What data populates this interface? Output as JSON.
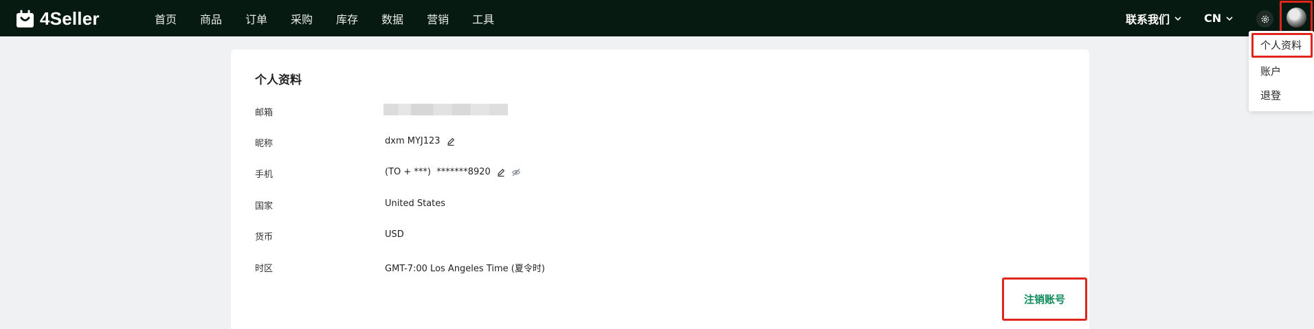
{
  "brand": {
    "name": "4Seller"
  },
  "nav": {
    "items": [
      {
        "label": "首页"
      },
      {
        "label": "商品"
      },
      {
        "label": "订单"
      },
      {
        "label": "采购"
      },
      {
        "label": "库存"
      },
      {
        "label": "数据"
      },
      {
        "label": "营销"
      },
      {
        "label": "工具"
      }
    ],
    "contact_label": "联系我们",
    "lang_label": "CN"
  },
  "user_menu": {
    "items": [
      {
        "label": "个人资料"
      },
      {
        "label": "账户"
      },
      {
        "label": "退登"
      }
    ]
  },
  "profile": {
    "title": "个人资料",
    "fields": {
      "email": {
        "label": "邮箱"
      },
      "nickname": {
        "label": "昵称",
        "value": "dxm MYJ123"
      },
      "phone": {
        "label": "手机",
        "value": "(TO + ***)  *******8920"
      },
      "country": {
        "label": "国家",
        "value": "United States"
      },
      "currency": {
        "label": "货币",
        "value": "USD"
      },
      "timezone": {
        "label": "时区",
        "value": "GMT-7:00 Los Angeles Time (夏令时)"
      }
    },
    "delete_label": "注销账号"
  },
  "colors": {
    "topbar": "#071a12",
    "page_bg": "#f0f1f3",
    "accent_green": "#0d8a5a",
    "highlight_red": "#e0251c"
  },
  "icons": {
    "edit": "edit-icon",
    "hide": "eye-hidden-icon",
    "settings": "gear-icon",
    "dropdown": "chevron-down-icon"
  }
}
